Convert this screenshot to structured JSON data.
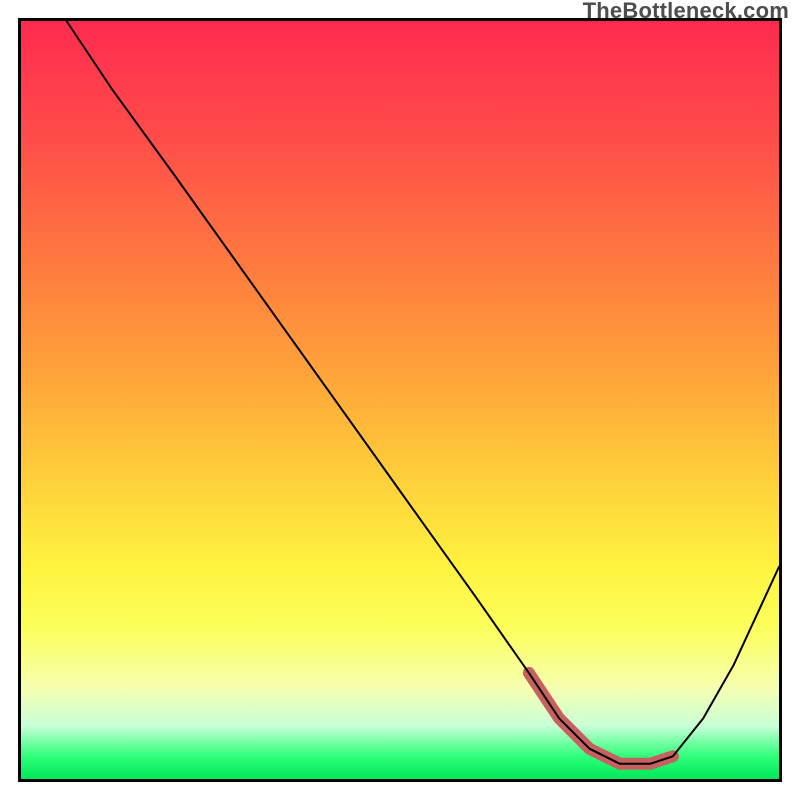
{
  "watermark": "TheBottleneck.com",
  "chart_data": {
    "type": "line",
    "title": "",
    "xlabel": "",
    "ylabel": "",
    "xlim": [
      0,
      100
    ],
    "ylim": [
      0,
      100
    ],
    "grid": false,
    "background_gradient": {
      "top": "#ff2a4f",
      "bottom": "#00e85a"
    },
    "series": [
      {
        "name": "bottleneck-curve",
        "color": "#000000",
        "stroke_width": 2,
        "x": [
          6,
          12,
          20,
          30,
          40,
          50,
          60,
          67,
          71,
          75,
          79,
          83,
          86,
          90,
          94,
          100
        ],
        "y": [
          100,
          91,
          80,
          66,
          52,
          38,
          24,
          14,
          8,
          4,
          2,
          2,
          3,
          8,
          15,
          28
        ]
      },
      {
        "name": "optimal-band",
        "color": "#c86060",
        "stroke_width": 12,
        "stroke_linecap": "round",
        "x": [
          67,
          71,
          75,
          79,
          83,
          86
        ],
        "y": [
          14,
          8,
          4,
          2,
          2,
          3
        ]
      }
    ]
  }
}
